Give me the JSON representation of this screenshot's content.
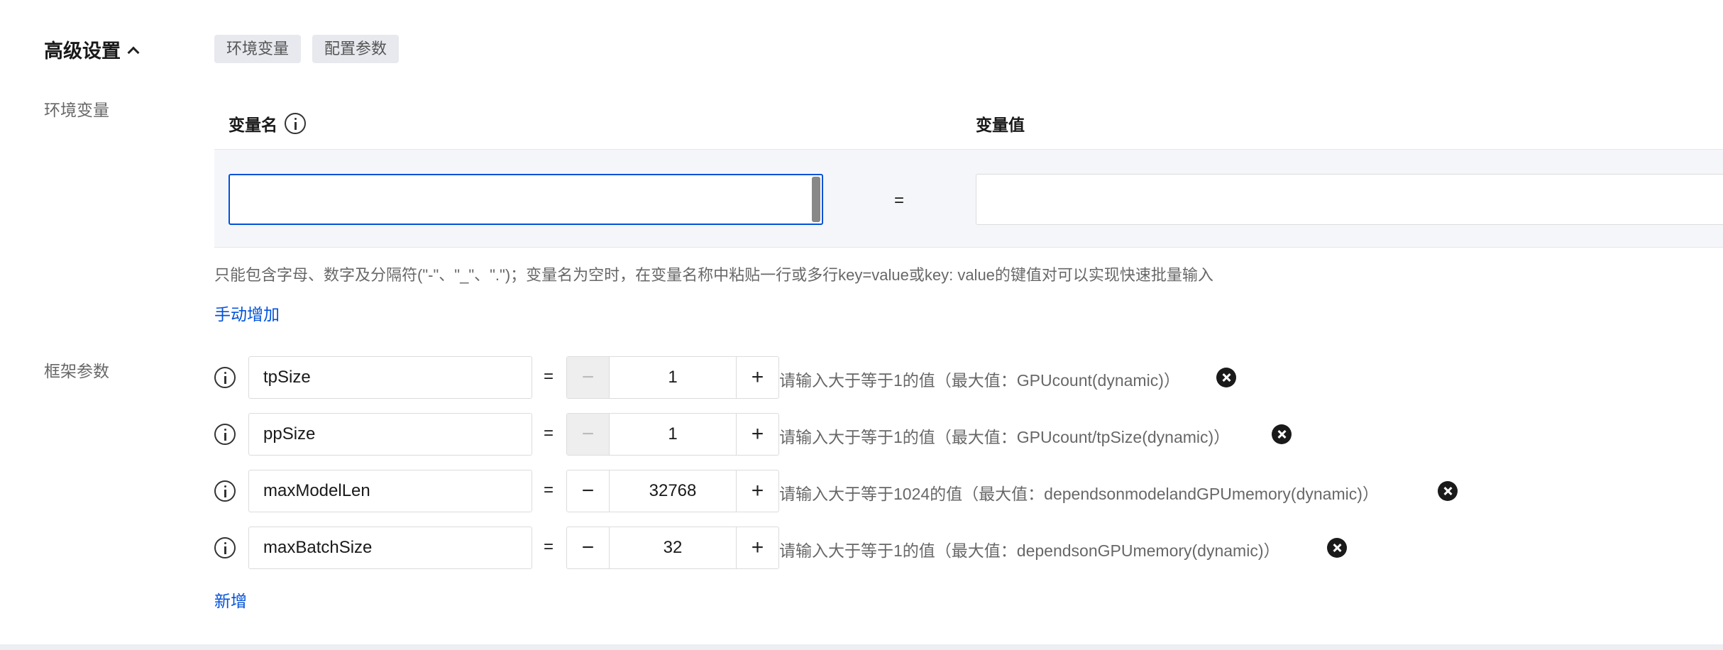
{
  "section": {
    "title": "高级设置"
  },
  "tabs": [
    {
      "label": "环境变量"
    },
    {
      "label": "配置参数"
    }
  ],
  "env": {
    "label": "环境变量",
    "name_header": "变量名",
    "value_header": "变量值",
    "name_value": "",
    "value_value": "",
    "equals": "=",
    "hint": "只能包含字母、数字及分隔符(\"-\"、\"_\"、\".\")；变量名为空时，在变量名称中粘贴一行或多行key=value或key: value的键值对可以实现快速批量输入",
    "add_link": "手动增加"
  },
  "framework": {
    "label": "框架参数",
    "add_link": "新增",
    "params": [
      {
        "key": "tpSize",
        "value": "1",
        "minus_disabled": true,
        "hint": "请输入大于等于1的值（最大值：GPUcount(dynamic)）"
      },
      {
        "key": "ppSize",
        "value": "1",
        "minus_disabled": true,
        "hint": "请输入大于等于1的值（最大值：GPUcount/tpSize(dynamic)）"
      },
      {
        "key": "maxModelLen",
        "value": "32768",
        "minus_disabled": false,
        "hint": "请输入大于等于1024的值（最大值：dependsonmodelandGPUmemory(dynamic)）"
      },
      {
        "key": "maxBatchSize",
        "value": "32",
        "minus_disabled": false,
        "hint": "请输入大于等于1的值（最大值：dependsonGPUmemory(dynamic)）"
      }
    ]
  },
  "symbols": {
    "equals": "=",
    "minus": "−",
    "plus": "+"
  },
  "colors": {
    "link": "#0052d9",
    "focus_border": "#0052d9",
    "row_bg": "#f5f6fa"
  }
}
